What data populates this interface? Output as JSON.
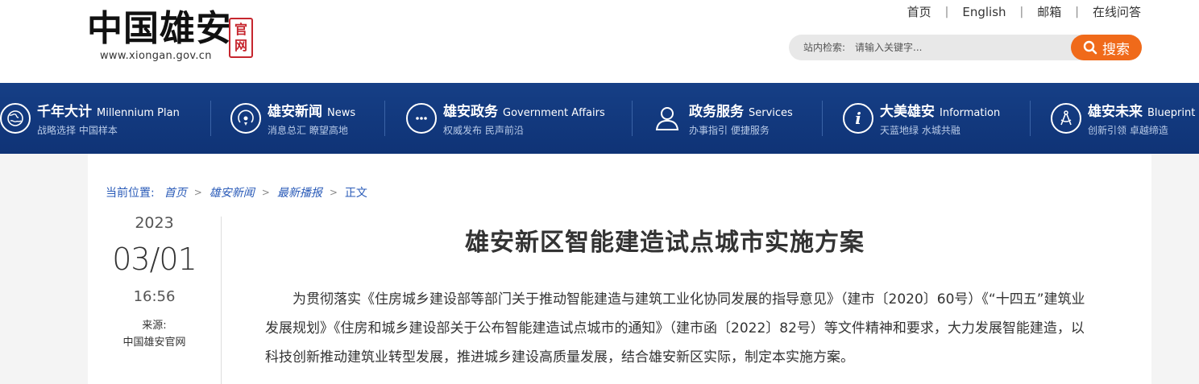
{
  "header": {
    "logo_title": "中国雄安",
    "logo_seal": "官网",
    "logo_url": "www.xiongan.gov.cn",
    "top_links": [
      "首页",
      "English",
      "邮箱",
      "在线问答"
    ],
    "search": {
      "label": "站内检索:",
      "placeholder": "请输入关键字...",
      "button": "搜索"
    }
  },
  "nav": [
    {
      "cn": "千年大计",
      "en": "Millennium Plan",
      "sub": "战略选择 中国样本",
      "icon": "globe-icon"
    },
    {
      "cn": "雄安新闻",
      "en": "News",
      "sub": "消息总汇 瞭望高地",
      "icon": "news-icon"
    },
    {
      "cn": "雄安政务",
      "en": "Government Affairs",
      "sub": "权威发布 民声前沿",
      "icon": "chat-icon"
    },
    {
      "cn": "政务服务",
      "en": "Services",
      "sub": "办事指引 便捷服务",
      "icon": "person-icon"
    },
    {
      "cn": "大美雄安",
      "en": "Information",
      "sub": "天蓝地绿 水城共融",
      "icon": "info-icon"
    },
    {
      "cn": "雄安未来",
      "en": "Blueprint",
      "sub": "创新引领 卓越缔造",
      "icon": "compass-icon"
    }
  ],
  "breadcrumb": {
    "label": "当前位置:",
    "items": [
      "首页",
      "雄安新闻",
      "最新播报"
    ],
    "current": "正文",
    "arrow": ">"
  },
  "date": {
    "year": "2023",
    "month_day": "03/01",
    "time": "16:56",
    "source_label": "来源:",
    "source": "中国雄安官网"
  },
  "article": {
    "title": "雄安新区智能建造试点城市实施方案",
    "body": "为贯彻落实《住房城乡建设部等部门关于推动智能建造与建筑工业化协同发展的指导意见》（建市〔2020〕60号）《“十四五”建筑业发展规划》《住房和城乡建设部关于公布智能建造试点城市的通知》（建市函〔2022〕82号）等文件精神和要求，大力发展智能建造，以科技创新推动建筑业转型发展，推进城乡建设高质量发展，结合雄安新区实际，制定本实施方案。"
  },
  "colors": {
    "nav_bg": "#163f86",
    "search_button": "#f06a1a",
    "link": "#2a5bb8",
    "seal": "#c6262e"
  }
}
